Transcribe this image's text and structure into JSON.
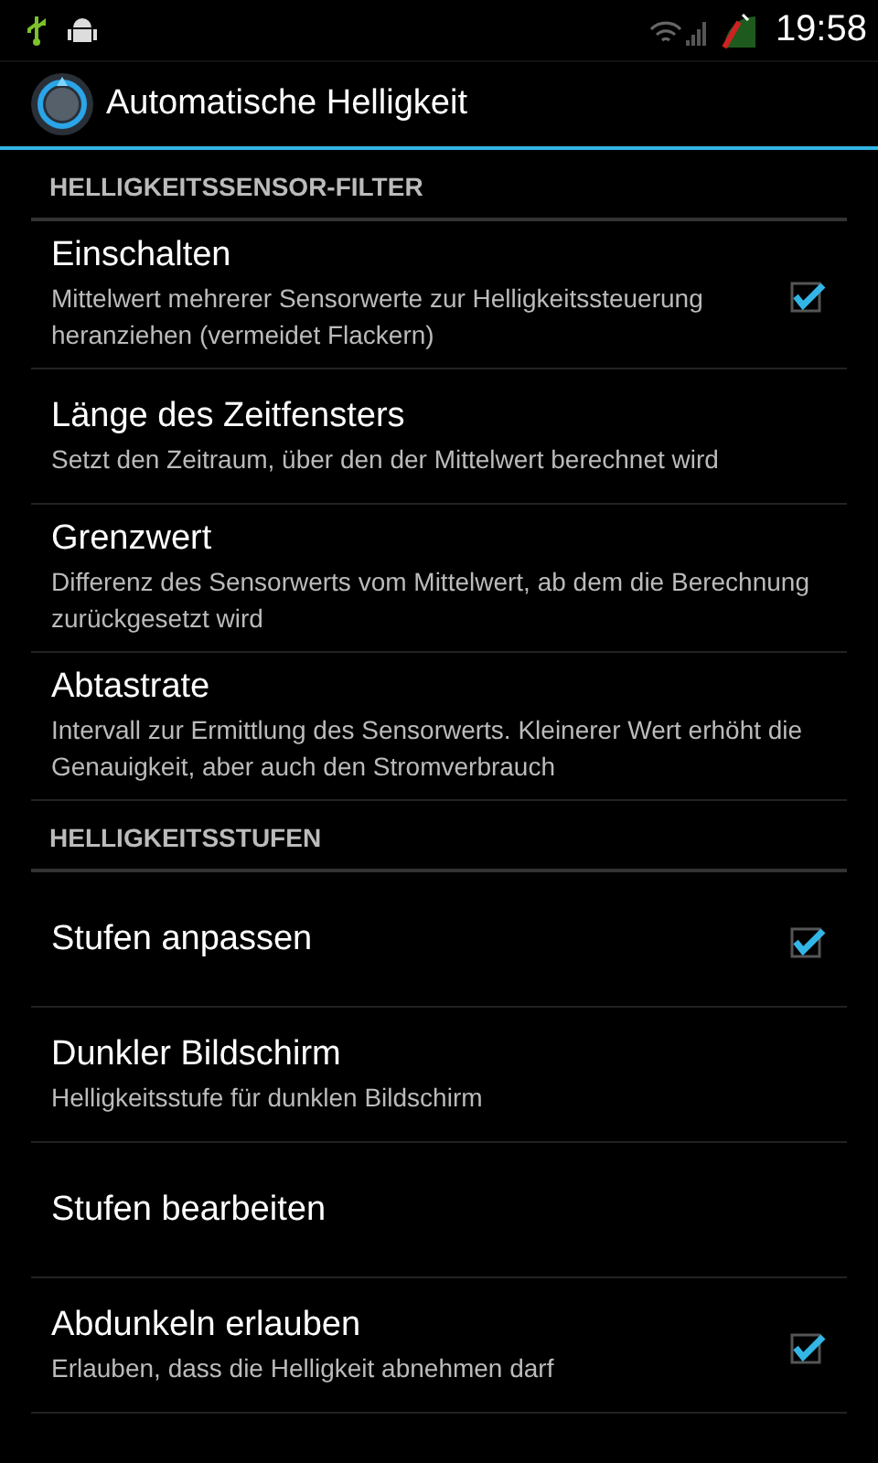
{
  "status_bar": {
    "time": "19:58"
  },
  "action_bar": {
    "title": "Automatische Helligkeit"
  },
  "sections": [
    {
      "title": "HELLIGKEITSSENSOR-FILTER",
      "items": [
        {
          "kind": "checkbox",
          "title": "Einschalten",
          "summary": "Mittelwert mehrerer Sensorwerte zur Helligkeitssteuerung heranziehen (vermeidet Flackern)",
          "checked": true
        },
        {
          "kind": "plain",
          "title": "Länge des Zeitfensters",
          "summary": "Setzt den Zeitraum, über den der Mittelwert berechnet wird"
        },
        {
          "kind": "plain",
          "title": "Grenzwert",
          "summary": "Differenz des Sensorwerts vom Mittelwert, ab dem die Berechnung zurückgesetzt wird"
        },
        {
          "kind": "plain",
          "title": "Abtastrate",
          "summary": "Intervall zur Ermittlung des Sensorwerts. Kleinerer Wert erhöht die Genauigkeit, aber auch den Stromverbrauch"
        }
      ]
    },
    {
      "title": "HELLIGKEITSSTUFEN",
      "items": [
        {
          "kind": "checkbox",
          "title": "Stufen anpassen",
          "checked": true
        },
        {
          "kind": "plain",
          "title": "Dunkler Bildschirm",
          "summary": "Helligkeitsstufe für dunklen Bildschirm"
        },
        {
          "kind": "plain",
          "title": "Stufen bearbeiten"
        },
        {
          "kind": "checkbox",
          "title": "Abdunkeln erlauben",
          "summary": "Erlauben, dass die Helligkeit abnehmen darf",
          "checked": true
        }
      ]
    }
  ]
}
